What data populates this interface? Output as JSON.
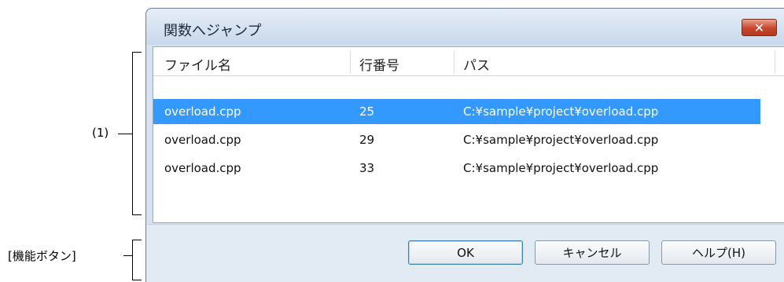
{
  "annotations": {
    "list_marker": "(1)",
    "buttons_marker": "[機能ボタン]"
  },
  "dialog": {
    "title": "関数へジャンプ",
    "close_glyph": "✕"
  },
  "table": {
    "columns": [
      "ファイル名",
      "行番号",
      "パス"
    ],
    "rows": [
      {
        "file": "overload.cpp",
        "line": "25",
        "path": "C:¥sample¥project¥overload.cpp",
        "selected": true
      },
      {
        "file": "overload.cpp",
        "line": "29",
        "path": "C:¥sample¥project¥overload.cpp",
        "selected": false
      },
      {
        "file": "overload.cpp",
        "line": "33",
        "path": "C:¥sample¥project¥overload.cpp",
        "selected": false
      }
    ]
  },
  "buttons": {
    "ok": "OK",
    "cancel": "キャンセル",
    "help": "ヘルプ(H)"
  },
  "colors": {
    "selection": "#3399ff",
    "close_button": "#c8452d"
  }
}
